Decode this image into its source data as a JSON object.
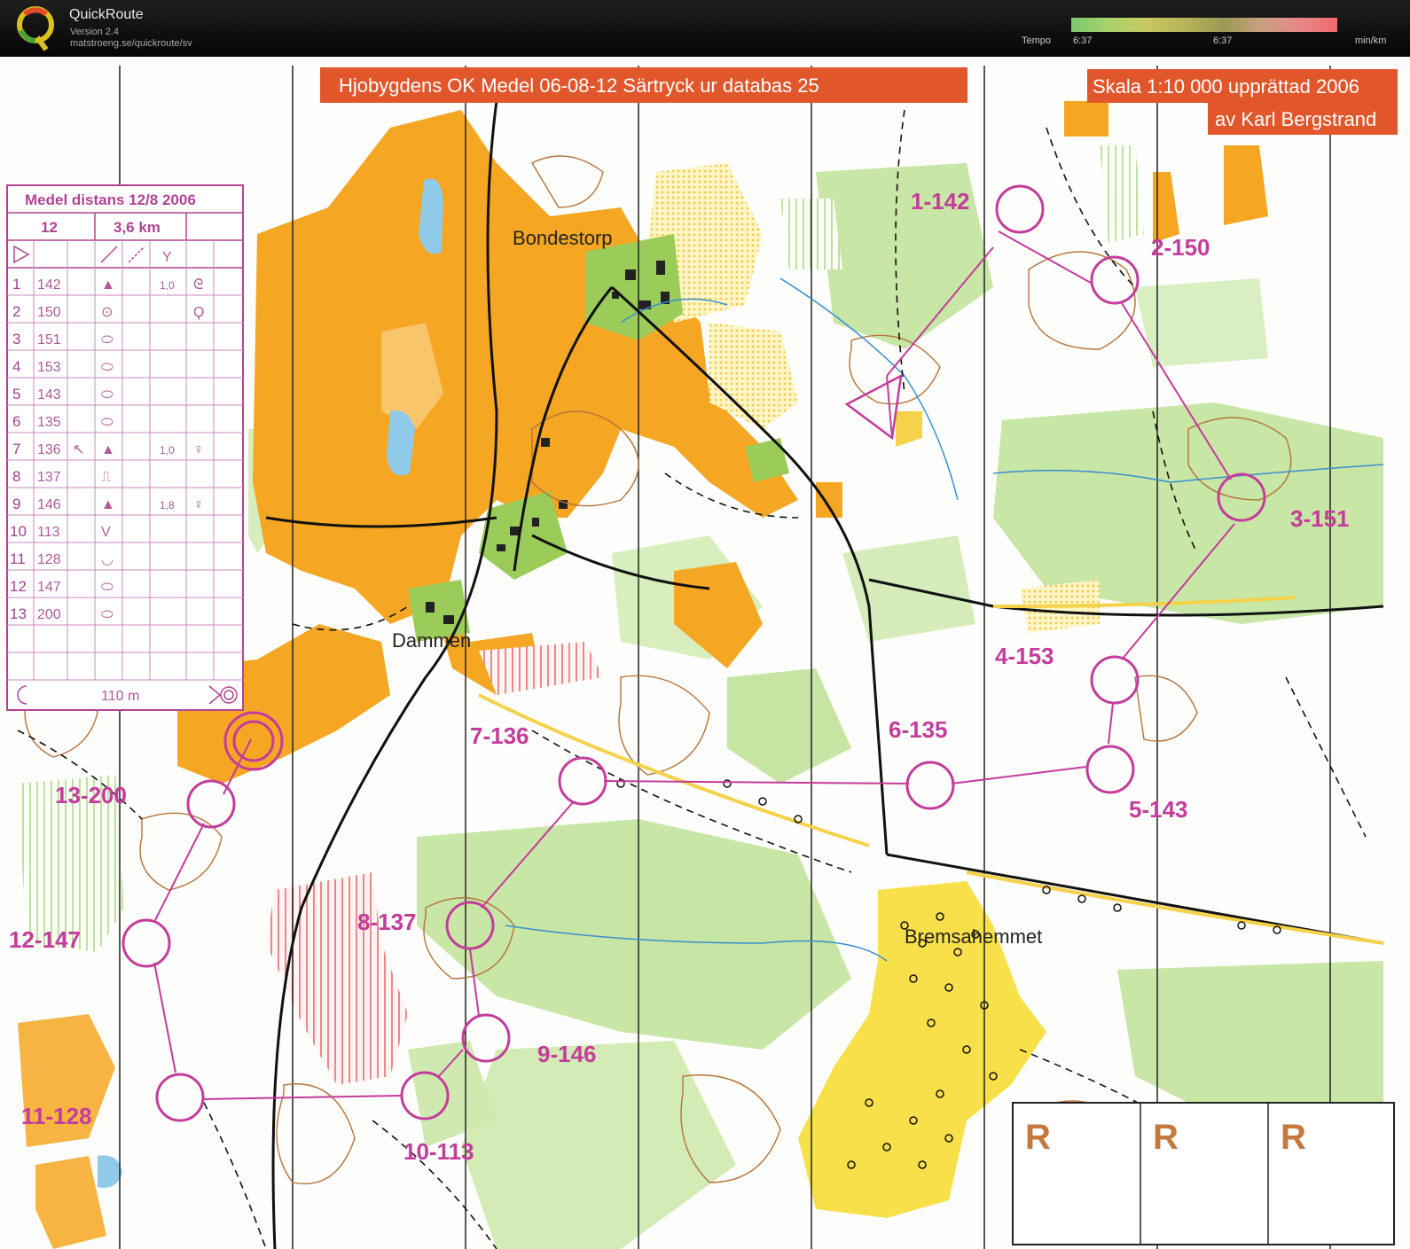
{
  "app": {
    "name": "QuickRoute",
    "version": "Version 2.4",
    "url": "matstroeng.se/quickroute/sv"
  },
  "tempo": {
    "label": "Tempo",
    "min": "6:37",
    "mid": "6:37",
    "unit": "min/km"
  },
  "map": {
    "banner_title": "Hjobygdens OK Medel 06-08-12 Särtryck ur databas  25",
    "scale_line1": "Skala 1:10 000 upprättad 2006",
    "scale_line2": "av Karl Bergstrand",
    "places": {
      "bondestorp": "Bondestorp",
      "dammen": "Dammen",
      "bremsahemmet": "Bremsahemmet"
    },
    "controls": [
      {
        "label": "1-142"
      },
      {
        "label": "2-150"
      },
      {
        "label": "3-151"
      },
      {
        "label": "4-153"
      },
      {
        "label": "5-143"
      },
      {
        "label": "6-135"
      },
      {
        "label": "7-136"
      },
      {
        "label": "8-137"
      },
      {
        "label": "9-146"
      },
      {
        "label": "10-113"
      },
      {
        "label": "11-128"
      },
      {
        "label": "12-147"
      },
      {
        "label": "13-200"
      }
    ],
    "r_box": [
      "R",
      "R",
      "R"
    ]
  },
  "description": {
    "title": "Medel distans 12/8 2006",
    "course": "12",
    "length": "3,6 km",
    "rows": [
      {
        "n": "1",
        "code": "142",
        "sym": "▲",
        "dim": "1,0",
        "extra": "ᘓ"
      },
      {
        "n": "2",
        "code": "150",
        "sym": "⊙",
        "dim": "",
        "extra": "Ϙ"
      },
      {
        "n": "3",
        "code": "151",
        "sym": "⬭",
        "dim": "",
        "extra": ""
      },
      {
        "n": "4",
        "code": "153",
        "sym": "⬭",
        "dim": "",
        "extra": ""
      },
      {
        "n": "5",
        "code": "143",
        "sym": "⬭",
        "dim": "",
        "extra": ""
      },
      {
        "n": "6",
        "code": "135",
        "sym": "⬭",
        "dim": "",
        "extra": ""
      },
      {
        "n": "7",
        "code": "136",
        "sym": "▲",
        "dim": "1,0",
        "extra": "♀"
      },
      {
        "n": "8",
        "code": "137",
        "sym": "⎍",
        "dim": "",
        "extra": ""
      },
      {
        "n": "9",
        "code": "146",
        "sym": "▲",
        "dim": "1,8",
        "extra": "♀"
      },
      {
        "n": "10",
        "code": "113",
        "sym": "V",
        "dim": "",
        "extra": ""
      },
      {
        "n": "11",
        "code": "128",
        "sym": "◡",
        "dim": "",
        "extra": ""
      },
      {
        "n": "12",
        "code": "147",
        "sym": "⬭",
        "dim": "",
        "extra": ""
      },
      {
        "n": "13",
        "code": "200",
        "sym": "⬭",
        "dim": "",
        "extra": ""
      }
    ],
    "finish_distance": "110 m"
  },
  "colors": {
    "course": "#c43c9c",
    "open_land": "#f5a623",
    "forest_green": "#c9e8a8",
    "banner": "#e2562b"
  }
}
